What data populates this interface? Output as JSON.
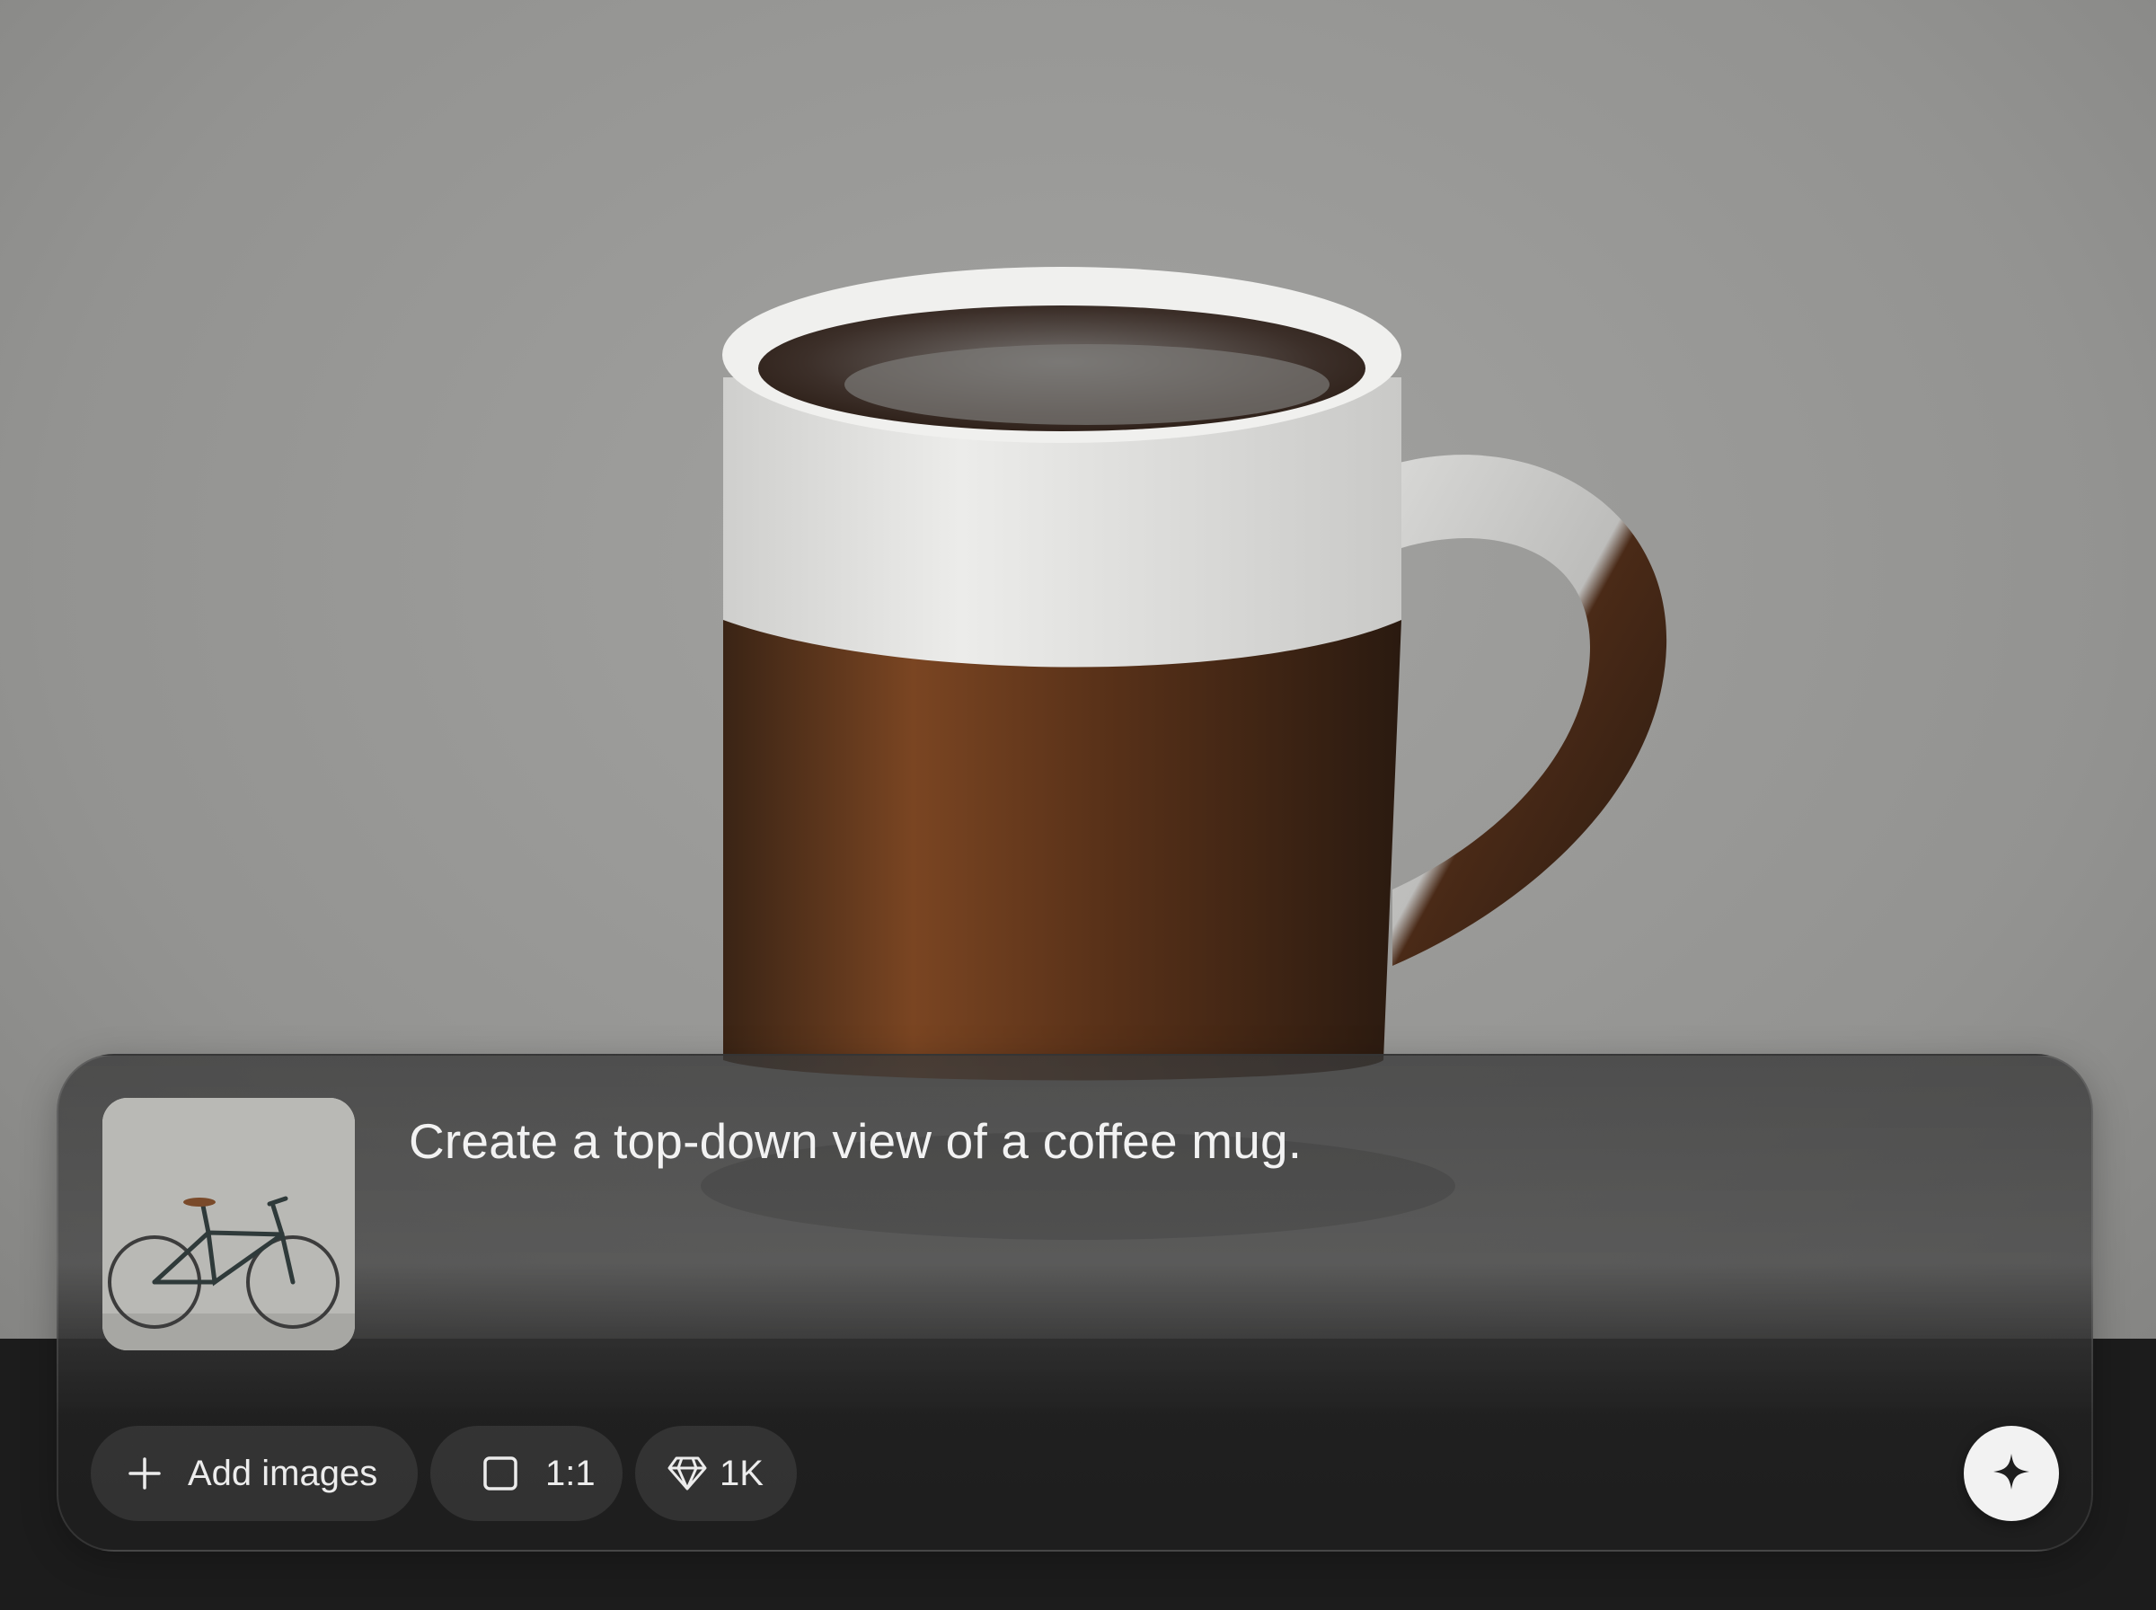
{
  "prompt": {
    "text": "Create a top-down view of a coffee mug."
  },
  "reference_image": {
    "subject": "bicycle-against-concrete-wall"
  },
  "toolbar": {
    "add_images_label": "Add images",
    "add_images_icon": "plus-icon",
    "aspect_ratio_label": "1:1",
    "aspect_ratio_icon": "square-icon",
    "resolution_label": "1K",
    "resolution_icon": "diamond-icon"
  },
  "generate_button": {
    "icon": "sparkle-icon"
  },
  "colors": {
    "background_wall": "#8f8f8d",
    "table_surface": "#1c1c1c",
    "mug_white": "#e6e6e4",
    "coffee_brown": "#4a2a17",
    "panel_text": "#f2f2f2",
    "button_bg": "#f2f2f2"
  }
}
